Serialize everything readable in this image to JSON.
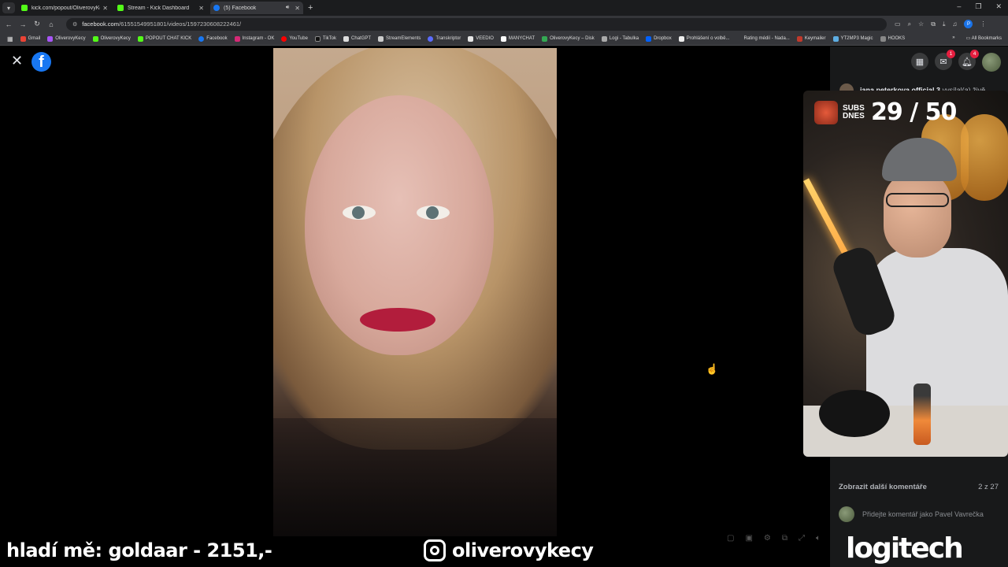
{
  "tabs": [
    {
      "title": "kick.com/popout/OliverovyKecy",
      "color": "#53fc18",
      "active": false
    },
    {
      "title": "Stream - Kick Dashboard",
      "color": "#53fc18",
      "active": false
    },
    {
      "title": "(5) Facebook",
      "color": "#1877f2",
      "active": true
    }
  ],
  "address": {
    "host": "facebook.com",
    "path": "/61551549951801/videos/1597230608222461/"
  },
  "bookmarks": [
    "Gmail",
    "OliverovyKecy",
    "OliverovyKecy",
    "POPOUT CHAT KICK",
    "Facebook",
    "Instagram - OK",
    "YouTube",
    "TikTok",
    "ChatGPT",
    "StreamElements",
    "Transkriptor",
    "VEEDIO",
    "MANYCHAT",
    "OliverovyKecy – Disk",
    "Logi - Tabulka",
    "Dropbox",
    "Prohlášení o volbě...",
    "Rating médií - Nada...",
    "Keymailer",
    "YT2MP3 Magic",
    "HOOKS"
  ],
  "all_bookmarks": "All Bookmarks",
  "fb": {
    "messenger_badge": "1",
    "notif_badge": "4",
    "live_name": "jana peterkova official 3",
    "live_action": "vysílal(a) živě",
    "more_comments": "Zobrazit další komentáře",
    "comment_count": "2 z 27",
    "comment_placeholder": "Přidejte komentář jako Pavel Vavrečka"
  },
  "overlay": {
    "subs_label": "SUBS DNES",
    "subs_count": "29 / 50",
    "left_text": "hladí mě: goldaar - 2151,-",
    "instagram": "oliverovykecy",
    "brand": "logitech"
  }
}
